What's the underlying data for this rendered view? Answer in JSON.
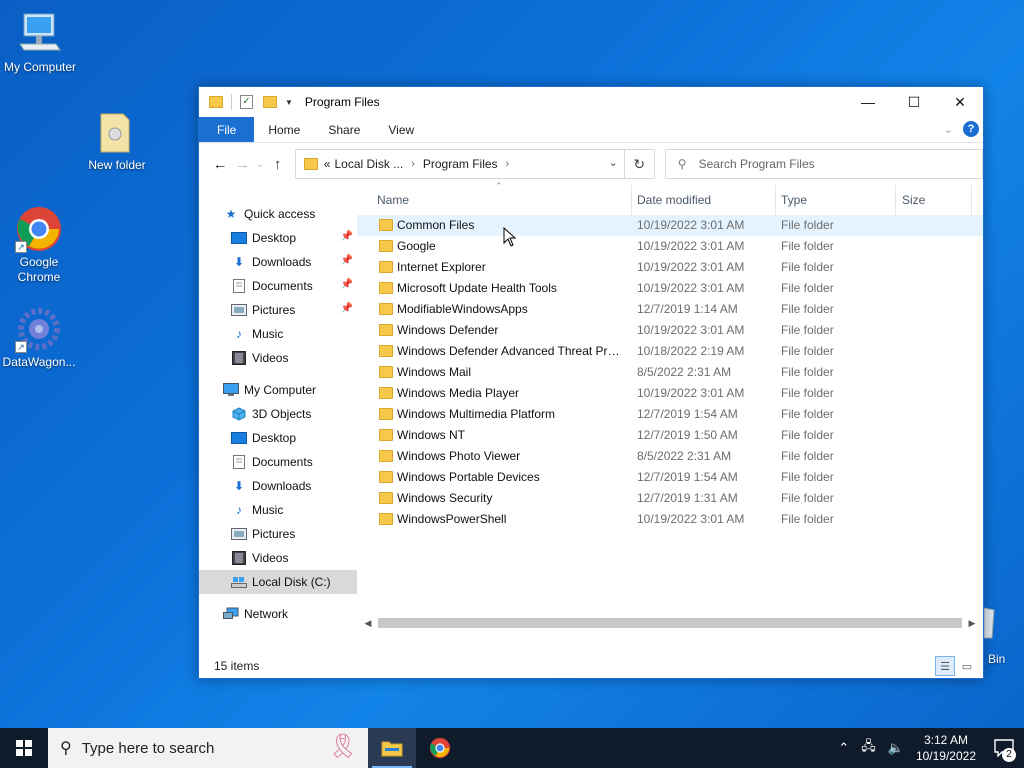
{
  "desktop": {
    "icons": [
      {
        "label": "My Computer"
      },
      {
        "label": "New folder"
      },
      {
        "label": "Google Chrome"
      },
      {
        "label": "DataWagon..."
      }
    ],
    "recycle_bin_partial_label": "Bin"
  },
  "window": {
    "title": "Program Files",
    "ribbon_tabs": [
      "File",
      "Home",
      "Share",
      "View"
    ],
    "address": {
      "overflow": "«",
      "crumbs": [
        "Local Disk ...",
        "Program Files"
      ]
    },
    "search_placeholder": "Search Program Files",
    "nav_pane": {
      "quick_access": "Quick access",
      "quick_items": [
        "Desktop",
        "Downloads",
        "Documents",
        "Pictures",
        "Music",
        "Videos"
      ],
      "my_computer": "My Computer",
      "pc_items": [
        "3D Objects",
        "Desktop",
        "Documents",
        "Downloads",
        "Music",
        "Pictures",
        "Videos",
        "Local Disk (C:)"
      ],
      "network": "Network"
    },
    "columns": {
      "name": "Name",
      "date": "Date modified",
      "type": "Type",
      "size": "Size"
    },
    "rows": [
      {
        "name": "Common Files",
        "date": "10/19/2022 3:01 AM",
        "type": "File folder"
      },
      {
        "name": "Google",
        "date": "10/19/2022 3:01 AM",
        "type": "File folder"
      },
      {
        "name": "Internet Explorer",
        "date": "10/19/2022 3:01 AM",
        "type": "File folder"
      },
      {
        "name": "Microsoft Update Health Tools",
        "date": "10/19/2022 3:01 AM",
        "type": "File folder"
      },
      {
        "name": "ModifiableWindowsApps",
        "date": "12/7/2019 1:14 AM",
        "type": "File folder"
      },
      {
        "name": "Windows Defender",
        "date": "10/19/2022 3:01 AM",
        "type": "File folder"
      },
      {
        "name": "Windows Defender Advanced Threat Prot...",
        "date": "10/18/2022 2:19 AM",
        "type": "File folder"
      },
      {
        "name": "Windows Mail",
        "date": "8/5/2022 2:31 AM",
        "type": "File folder"
      },
      {
        "name": "Windows Media Player",
        "date": "10/19/2022 3:01 AM",
        "type": "File folder"
      },
      {
        "name": "Windows Multimedia Platform",
        "date": "12/7/2019 1:54 AM",
        "type": "File folder"
      },
      {
        "name": "Windows NT",
        "date": "12/7/2019 1:50 AM",
        "type": "File folder"
      },
      {
        "name": "Windows Photo Viewer",
        "date": "8/5/2022 2:31 AM",
        "type": "File folder"
      },
      {
        "name": "Windows Portable Devices",
        "date": "12/7/2019 1:54 AM",
        "type": "File folder"
      },
      {
        "name": "Windows Security",
        "date": "12/7/2019 1:31 AM",
        "type": "File folder"
      },
      {
        "name": "WindowsPowerShell",
        "date": "10/19/2022 3:01 AM",
        "type": "File folder"
      }
    ],
    "status": "15 items"
  },
  "taskbar": {
    "search_text": "Type here to search",
    "time": "3:12 AM",
    "date": "10/19/2022",
    "notification_count": "2"
  },
  "colors": {
    "accent": "#1a6fd0",
    "folder": "#f6c94a",
    "desktop": "#0b6fd8",
    "taskbar": "#0f1a2a"
  }
}
